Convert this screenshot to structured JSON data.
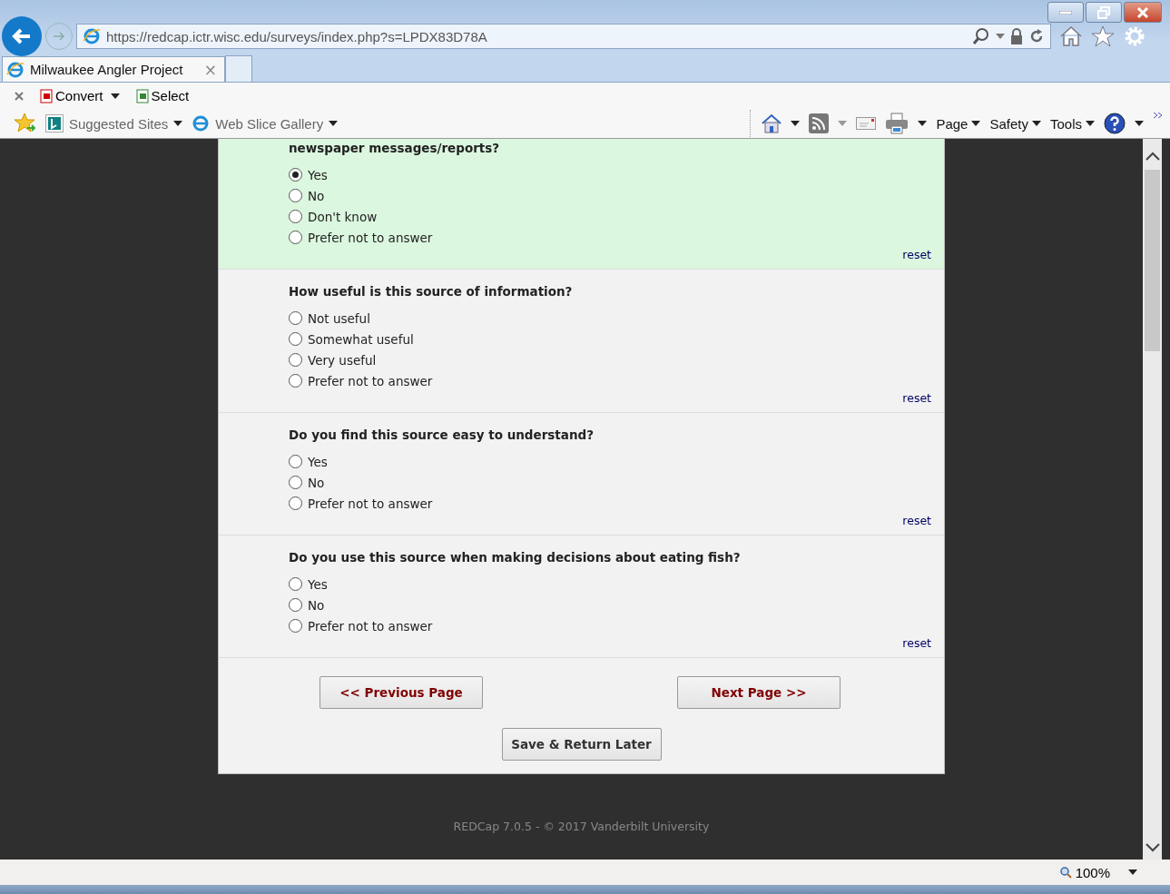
{
  "browser": {
    "address": "https://redcap.ictr.wisc.edu/surveys/index.php?s=LPDX83D78A",
    "tab_title": "Milwaukee Angler Project",
    "tab_close": "×",
    "command_bar": [
      "Convert",
      "Select"
    ],
    "favorites": [
      "Suggested Sites",
      "Web Slice Gallery"
    ],
    "menus": [
      "Page",
      "Safety",
      "Tools"
    ],
    "zoom": "100%"
  },
  "survey": {
    "questions": [
      {
        "label": "newspaper messages/reports?",
        "highlighted": true,
        "reset": "reset",
        "options": [
          {
            "label": "Yes",
            "selected": true
          },
          {
            "label": "No",
            "selected": false
          },
          {
            "label": "Don't know",
            "selected": false
          },
          {
            "label": "Prefer not to answer",
            "selected": false
          }
        ]
      },
      {
        "label": "How useful is this source of information?",
        "highlighted": false,
        "reset": "reset",
        "options": [
          {
            "label": "Not useful",
            "selected": false
          },
          {
            "label": "Somewhat useful",
            "selected": false
          },
          {
            "label": "Very useful",
            "selected": false
          },
          {
            "label": "Prefer not to answer",
            "selected": false
          }
        ]
      },
      {
        "label": "Do you find this source easy to understand?",
        "highlighted": false,
        "reset": "reset",
        "options": [
          {
            "label": "Yes",
            "selected": false
          },
          {
            "label": "No",
            "selected": false
          },
          {
            "label": "Prefer not to answer",
            "selected": false
          }
        ]
      },
      {
        "label": "Do you use this source when making decisions about eating fish?",
        "highlighted": false,
        "reset": "reset",
        "options": [
          {
            "label": "Yes",
            "selected": false
          },
          {
            "label": "No",
            "selected": false
          },
          {
            "label": "Prefer not to answer",
            "selected": false
          }
        ]
      }
    ],
    "previous": "<< Previous Page",
    "next": "Next Page >>",
    "save": "Save & Return Later",
    "footer": "REDCap 7.0.5 - © 2017 Vanderbilt University"
  }
}
